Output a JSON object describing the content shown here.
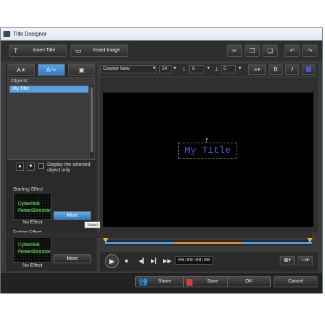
{
  "window": {
    "title": "Title Designer"
  },
  "toolbar": {
    "insert_title": "Insert Title",
    "insert_image": "Insert Image",
    "insert_title_icon": "T",
    "insert_image_icon": "▭",
    "icons": [
      "scissors-icon",
      "copy-icon",
      "paste-icon",
      "undo-icon",
      "redo-icon"
    ]
  },
  "tabs": [
    {
      "name": "text-style-tab",
      "glyph": "A✶"
    },
    {
      "name": "text-effect-tab",
      "glyph": "A〜",
      "active": true
    },
    {
      "name": "image-tab",
      "glyph": "▣"
    }
  ],
  "objects": {
    "label": "Objects:",
    "items": [
      "My Title"
    ]
  },
  "display_selected": {
    "label": "Display the selected object only",
    "checked": false
  },
  "starting_effect": {
    "label": "Starting Effect",
    "preview_line1": "Cyberlink",
    "preview_line2": "PowerDirector",
    "value": "No Effect",
    "more": "More"
  },
  "ending_effect": {
    "label": "Ending Effect",
    "preview_line1": "Cyberlink",
    "preview_line2": "PowerDirector",
    "value": "No Effect",
    "more": "More"
  },
  "tooltip": "Select the starting effect",
  "format": {
    "font": "Courier New",
    "size": "24",
    "line_spacing": "0",
    "char_spacing": "0",
    "bold": "B",
    "italic": "I"
  },
  "canvas": {
    "title_text": "My Title",
    "background": "#000000",
    "title_color": "#4a55c8"
  },
  "playback": {
    "timecode": "00:00:00:00"
  },
  "bottom": {
    "share": "Share",
    "save": "Save",
    "ok": "OK",
    "cancel": "Cancel"
  },
  "colors": {
    "accent": "#4aa3ea",
    "marker": "#e6b630",
    "middle_track": "#e08a2a"
  }
}
